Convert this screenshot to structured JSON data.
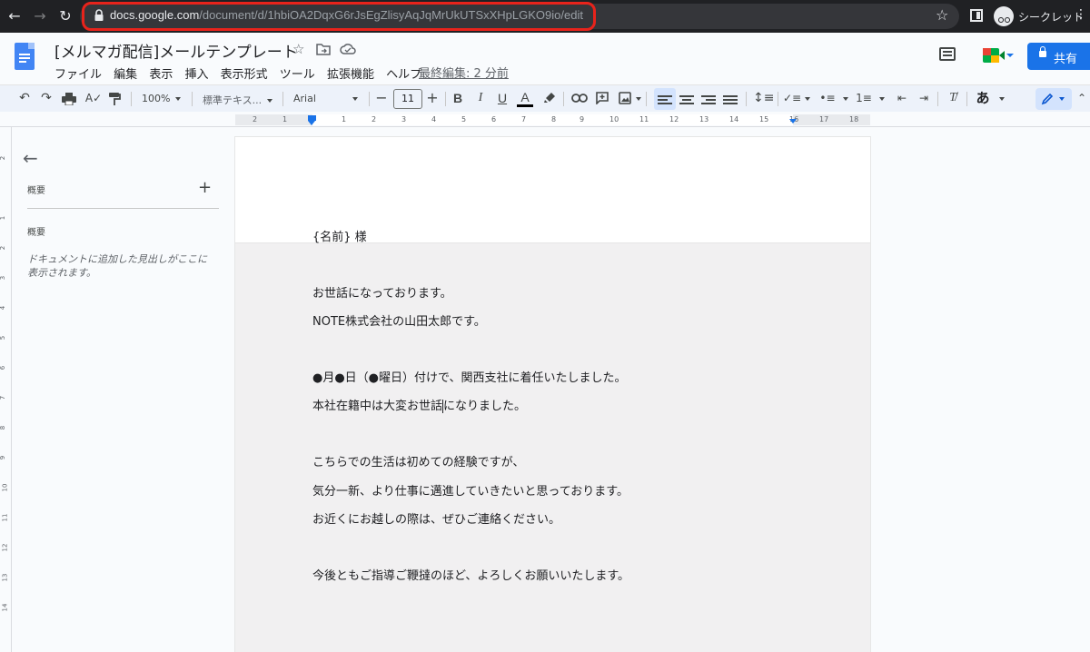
{
  "browser": {
    "url_domain": "docs.google.com",
    "url_path": "/document/d/1hbiOA2DqxG6rJsEgZlisyAqJqMrUkUTSxXHpLGKO9io/edit",
    "incognito_label": "シークレット"
  },
  "doc": {
    "title": "[メルマガ配信]メールテンプレート",
    "menus": [
      "ファイル",
      "編集",
      "表示",
      "挿入",
      "表示形式",
      "ツール",
      "拡張機能",
      "ヘルプ"
    ],
    "last_edit": "最終編集: 2 分前",
    "share_label": "共有"
  },
  "toolbar": {
    "zoom": "100%",
    "style": "標準テキス...",
    "font": "Arial",
    "font_size": "11",
    "ime": "あ"
  },
  "ruler": {
    "numbers": [
      "2",
      "1",
      "1",
      "2",
      "3",
      "4",
      "5",
      "6",
      "7",
      "8",
      "9",
      "10",
      "11",
      "12",
      "13",
      "14",
      "15",
      "16",
      "17",
      "18"
    ],
    "vertical": [
      "1",
      "2",
      "3",
      "4",
      "5",
      "6",
      "7",
      "8",
      "9",
      "10",
      "11",
      "12",
      "13",
      "14"
    ]
  },
  "outline": {
    "panel_title": "概要",
    "section_title": "概要",
    "empty_message": "ドキュメントに追加した見出しがここに表示されます。"
  },
  "document": {
    "lines": [
      "{名前} 様",
      "お世話になっております。",
      "NOTE株式会社の山田太郎です。",
      "●月●日（●曜日）付けで、関西支社に着任いたしました。",
      "本社在籍中は大変お世話",
      "になりました。",
      "こちらでの生活は初めての経験ですが、",
      "気分一新、より仕事に邁進していきたいと思っております。",
      "お近くにお越しの際は、ぜひご連絡ください。",
      "今後ともご指導ご鞭撻のほど、よろしくお願いいたします。"
    ]
  },
  "colors": {
    "share_blue": "#1a73e8",
    "url_highlight": "#e8231b"
  }
}
